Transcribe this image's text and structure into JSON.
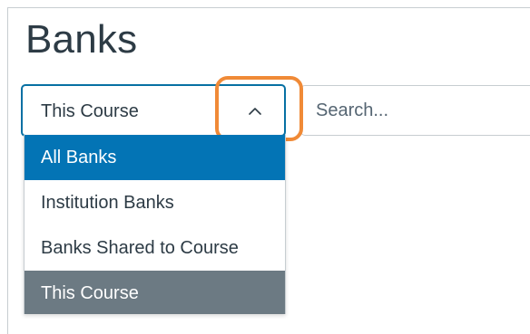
{
  "page": {
    "title": "Banks"
  },
  "bank_filter": {
    "selected": "This Course",
    "options": [
      "All Banks",
      "Institution Banks",
      "Banks Shared to Course",
      "This Course"
    ]
  },
  "search": {
    "placeholder": "Search..."
  },
  "colors": {
    "focus_border": "#0770a3",
    "highlighted_option": "#0374b5",
    "selected_option": "#6c7a83",
    "annotation": "#f08a37",
    "text": "#2d3b45"
  },
  "icons": {
    "dropdown": "chevron-up-icon"
  }
}
